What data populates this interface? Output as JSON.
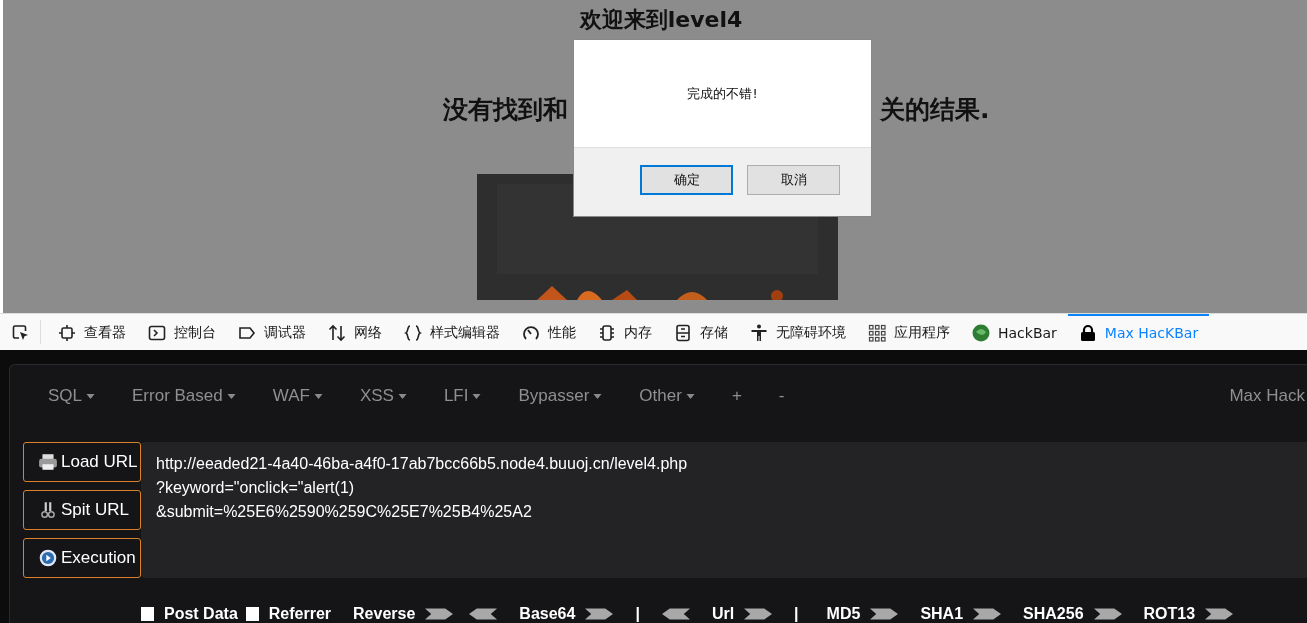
{
  "page": {
    "heading": "欢迎来到level4",
    "result_start": "没有找到和",
    "result_end": "关的结果."
  },
  "dialog": {
    "message": "完成的不错!",
    "buttons": [
      {
        "label": "确定",
        "selected": true
      },
      {
        "label": "取消",
        "selected": false
      }
    ]
  },
  "devtools_tabs": [
    {
      "kind": "pick",
      "selected": false
    },
    {
      "kind": "inspector",
      "label": "查看器",
      "selected": false
    },
    {
      "kind": "console",
      "label": "控制台",
      "selected": false
    },
    {
      "kind": "debugger",
      "label": "调试器",
      "selected": false
    },
    {
      "kind": "network",
      "label": "网络",
      "selected": false
    },
    {
      "kind": "style",
      "label": "样式编辑器",
      "selected": false
    },
    {
      "kind": "performance",
      "label": "性能",
      "selected": false
    },
    {
      "kind": "memory",
      "label": "内存",
      "selected": false
    },
    {
      "kind": "storage",
      "label": "存储",
      "selected": false
    },
    {
      "kind": "accessibility",
      "label": "无障碍环境",
      "selected": false
    },
    {
      "kind": "apps",
      "label": "应用程序",
      "selected": false
    },
    {
      "kind": "hackbar",
      "label": "HackBar",
      "selected": false
    },
    {
      "kind": "maxhackbar",
      "label": "Max HacKBar",
      "selected": true
    }
  ],
  "hackbar": {
    "menu": [
      {
        "label": "SQL",
        "dropdown": true
      },
      {
        "label": "Error Based",
        "dropdown": true
      },
      {
        "label": "WAF",
        "dropdown": true
      },
      {
        "label": "XSS",
        "dropdown": true
      },
      {
        "label": "LFI",
        "dropdown": true
      },
      {
        "label": "Bypasser",
        "dropdown": true
      },
      {
        "label": "Other",
        "dropdown": true
      },
      {
        "label": "+",
        "dropdown": false
      },
      {
        "label": "-",
        "dropdown": false
      }
    ],
    "brand": "Max Hack",
    "actions": [
      {
        "kind": "load",
        "label": "Load URL"
      },
      {
        "kind": "split",
        "label": "Spit URL"
      },
      {
        "kind": "execute",
        "label": "Execution"
      }
    ],
    "url_lines": [
      "http://eeaded21-4a40-46ba-a4f0-17ab7bcc66b5.node4.buuoj.cn/level4.php",
      "?keyword=\"onclick=\"alert(1)",
      "&submit=%25E6%2590%259C%25E7%25B4%25A2"
    ],
    "tools": [
      {
        "kind": "check",
        "label": "Post Data",
        "checked": false
      },
      {
        "kind": "check",
        "label": "Referrer",
        "checked": false
      },
      {
        "kind": "button",
        "label": "Reverse"
      },
      {
        "kind": "encode"
      },
      {
        "kind": "decode"
      },
      {
        "kind": "button",
        "label": "Base64"
      },
      {
        "kind": "encode"
      },
      {
        "kind": "separator",
        "label": "|"
      },
      {
        "kind": "decode"
      },
      {
        "kind": "button",
        "label": "Url"
      },
      {
        "kind": "encode"
      },
      {
        "kind": "separator",
        "label": "|"
      },
      {
        "kind": "button",
        "label": "MD5"
      },
      {
        "kind": "encode"
      },
      {
        "kind": "button",
        "label": "SHA1"
      },
      {
        "kind": "encode"
      },
      {
        "kind": "button",
        "label": "SHA256"
      },
      {
        "kind": "encode"
      },
      {
        "kind": "button",
        "label": "ROT13"
      },
      {
        "kind": "encode"
      }
    ]
  }
}
